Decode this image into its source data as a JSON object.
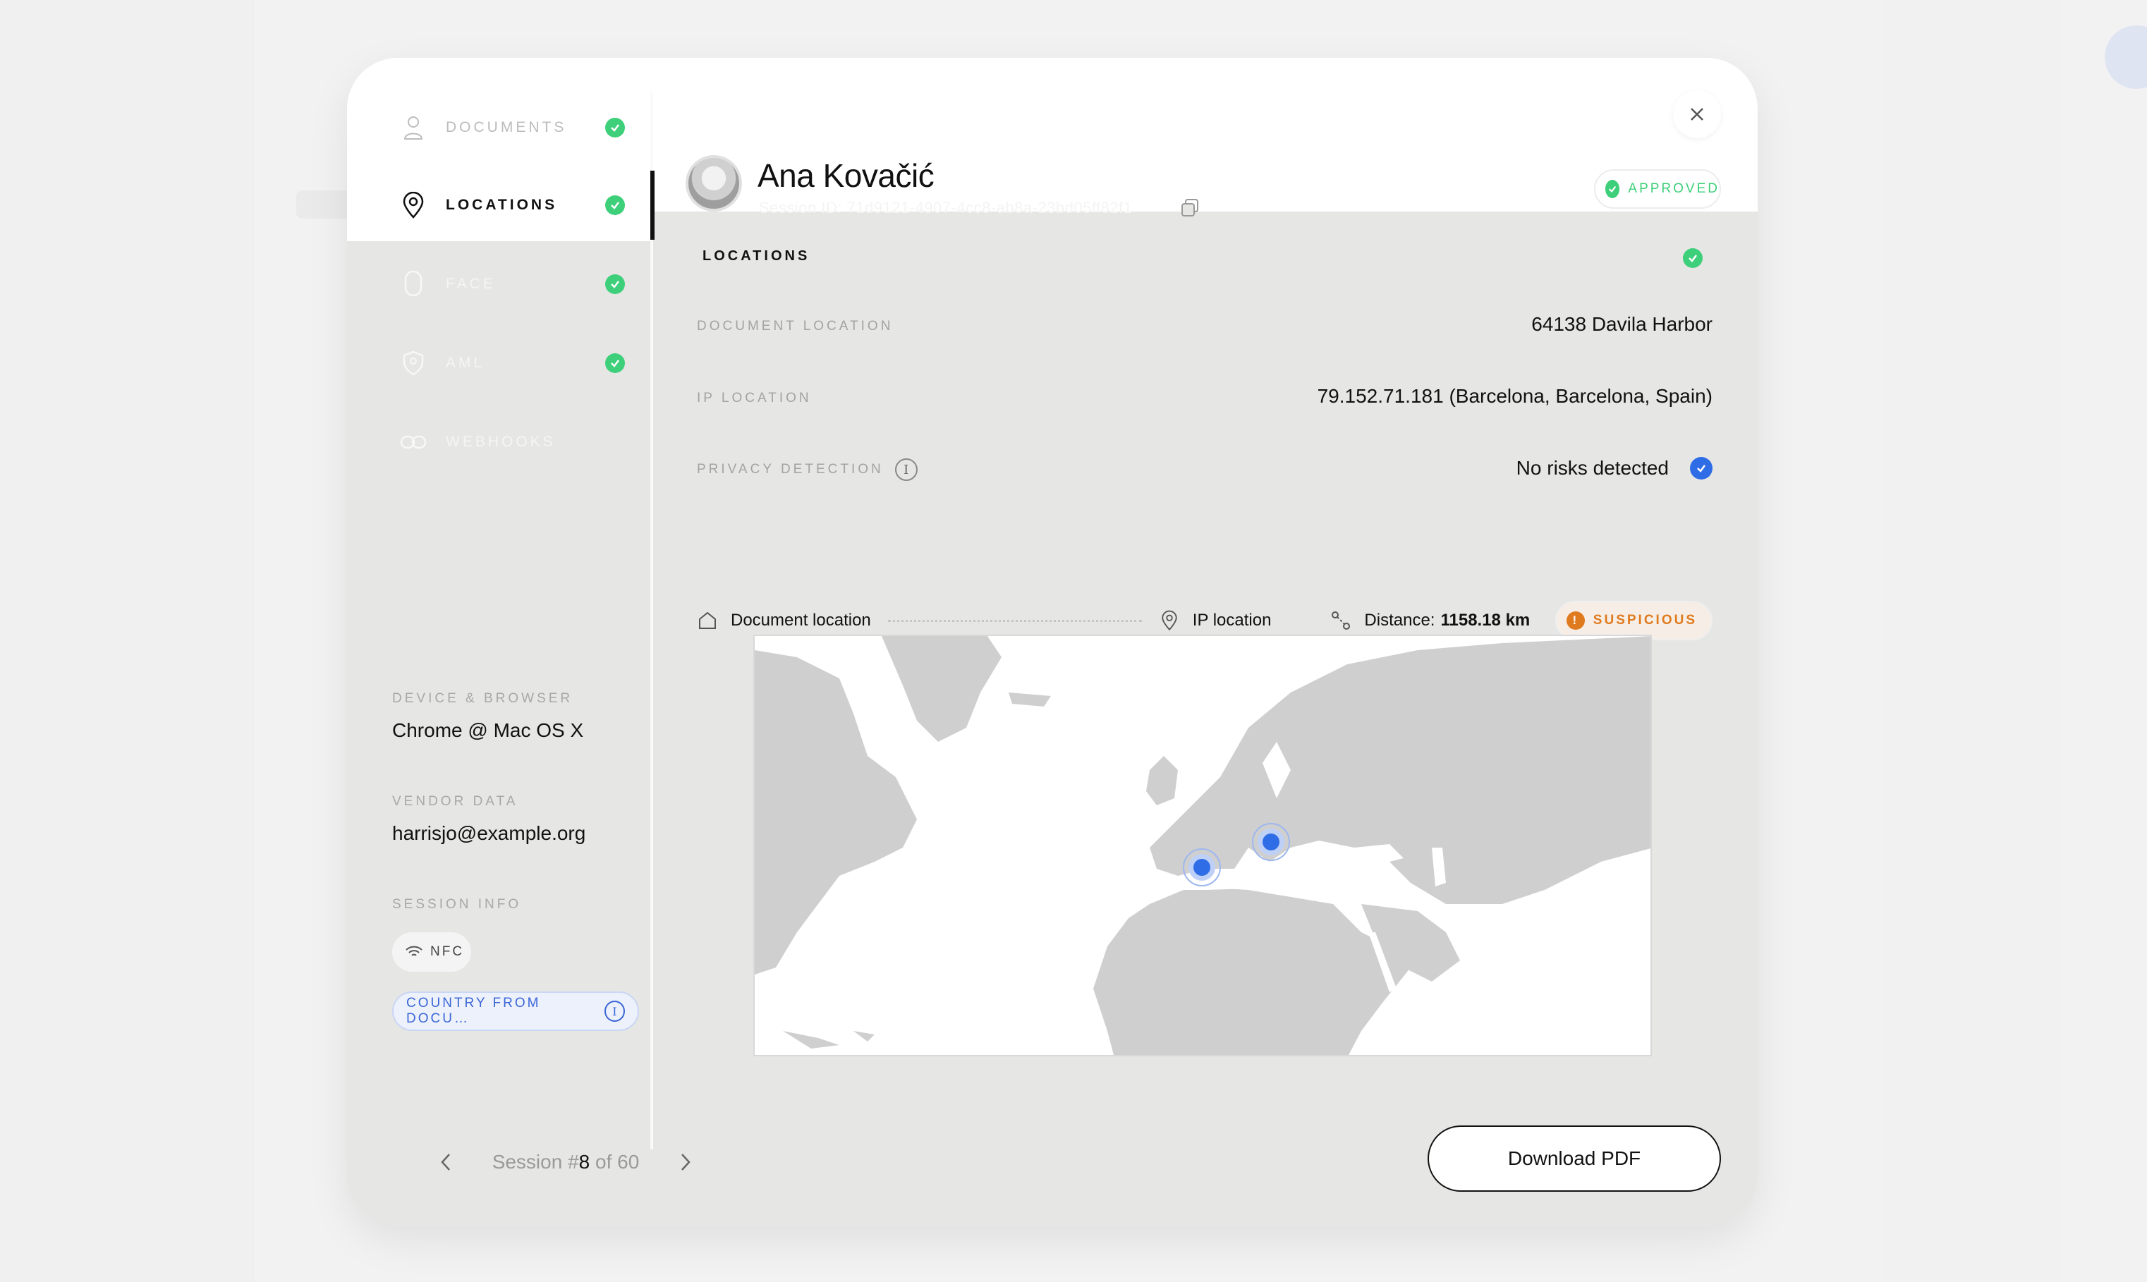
{
  "colors": {
    "success": "#3ecf7a",
    "accent_blue": "#2f6de6",
    "warning": "#e07a1f"
  },
  "nav": {
    "items": [
      {
        "label": "Documents",
        "icon": "user-icon",
        "checked": true
      },
      {
        "label": "Locations",
        "icon": "location-pin-icon",
        "checked": true,
        "active": true
      },
      {
        "label": "Face",
        "icon": "face-icon",
        "checked": true
      },
      {
        "label": "AML",
        "icon": "shield-user-icon",
        "checked": true
      },
      {
        "label": "Webhooks",
        "icon": "link-icon",
        "checked": false
      }
    ]
  },
  "sidebar": {
    "device_label": "Device & Browser",
    "device_value": "Chrome @ Mac OS X",
    "vendor_label": "Vendor Data",
    "vendor_value": "harrisjo@example.org",
    "session_info_label": "Session Info",
    "chip_nfc": "NFC",
    "chip_country": "Country from docu…"
  },
  "header": {
    "name": "Ana Kovačić",
    "session_id": "Session ID: 71d9121-4907-4cc8-ab8a-23bd05ff82f1",
    "status": "Approved"
  },
  "locations": {
    "title": "Locations",
    "rows": [
      {
        "label": "Document location",
        "value": "64138 Davila Harbor"
      },
      {
        "label": "IP location",
        "value": "79.152.71.181 (Barcelona, Barcelona, Spain)"
      },
      {
        "label": "Privacy detection",
        "value": "No risks detected"
      }
    ],
    "legend": {
      "doc_location": "Document location",
      "ip_location": "IP location",
      "distance_label": "Distance:",
      "distance_value": "1158.18 km",
      "flag": "Suspicious"
    }
  },
  "footer": {
    "session_prefix": "Session #",
    "session_current": "8",
    "session_suffix": " of 60",
    "download_label": "Download PDF"
  }
}
